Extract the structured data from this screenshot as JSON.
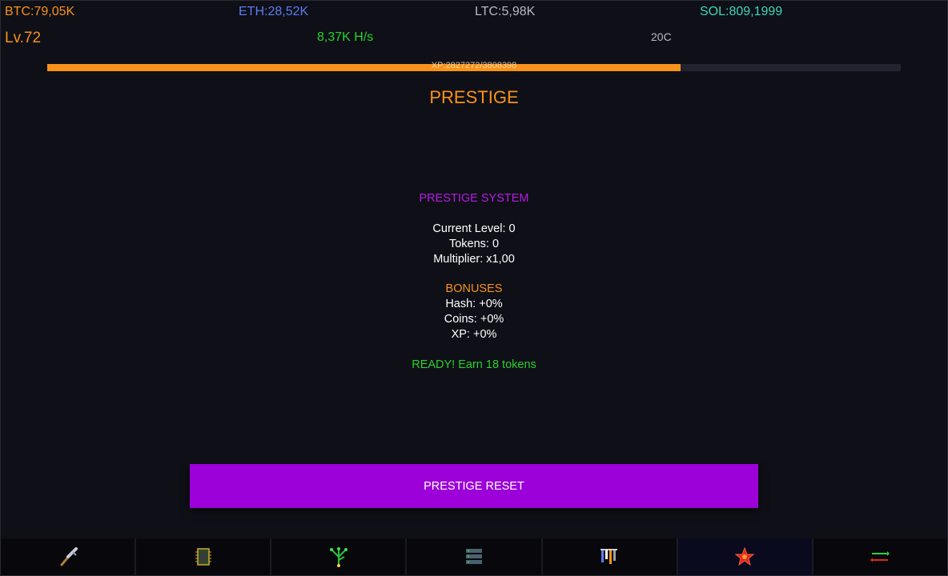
{
  "top_stats": {
    "btc": "BTC:79,05K",
    "eth": "ETH:28,52K",
    "ltc": "LTC:5,98K",
    "sol": "SOL:809,1999"
  },
  "status": {
    "level": "Lv.72",
    "hashrate": "8,37K H/s",
    "temperature": "20C"
  },
  "xp": {
    "text": "XP:2827272/3808398",
    "progress_fraction": 0.742
  },
  "page": {
    "title": "PRESTIGE"
  },
  "prestige": {
    "system_label": "PRESTIGE SYSTEM",
    "current_level": "Current Level: 0",
    "tokens": "Tokens: 0",
    "multiplier": "Multiplier: x1,00",
    "bonuses_label": "BONUSES",
    "bonus_hash": "Hash: +0%",
    "bonus_coins": "Coins: +0%",
    "bonus_xp": "XP: +0%",
    "ready_text": "READY! Earn 18 tokens",
    "reset_button": "PRESTIGE RESET"
  },
  "colors": {
    "btc": "#f7931a",
    "eth": "#5b7cf0",
    "sol": "#3ed6b6",
    "accent_purple": "#9b01d8",
    "green": "#27d12b"
  },
  "nav": [
    {
      "icon": "pickaxe-icon",
      "active": false
    },
    {
      "icon": "chip-icon",
      "active": false
    },
    {
      "icon": "tree-icon",
      "active": false
    },
    {
      "icon": "server-icon",
      "active": false
    },
    {
      "icon": "stats-icon",
      "active": false
    },
    {
      "icon": "prestige-star-icon",
      "active": true
    },
    {
      "icon": "exchange-icon",
      "active": false
    }
  ]
}
